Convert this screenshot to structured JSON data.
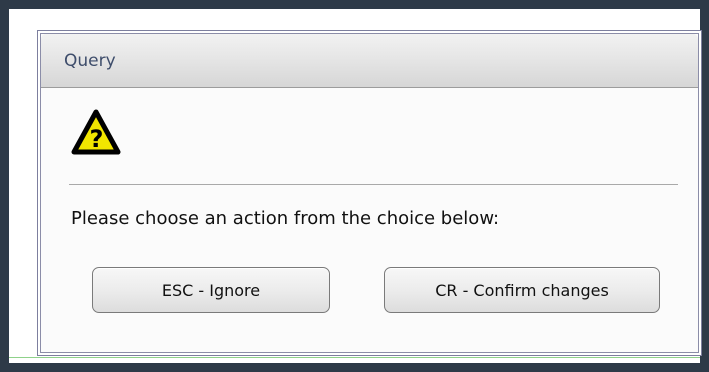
{
  "dialog": {
    "title": "Query",
    "icon": "warning-question-icon",
    "message": "Please choose an action from the choice below:",
    "buttons": {
      "ignore_label": "ESC - Ignore",
      "confirm_label": "CR - Confirm changes"
    }
  },
  "colors": {
    "frame": "#2e3a48",
    "title_text": "#3e4d6b",
    "icon_yellow": "#f2e600",
    "icon_border": "#000000"
  }
}
